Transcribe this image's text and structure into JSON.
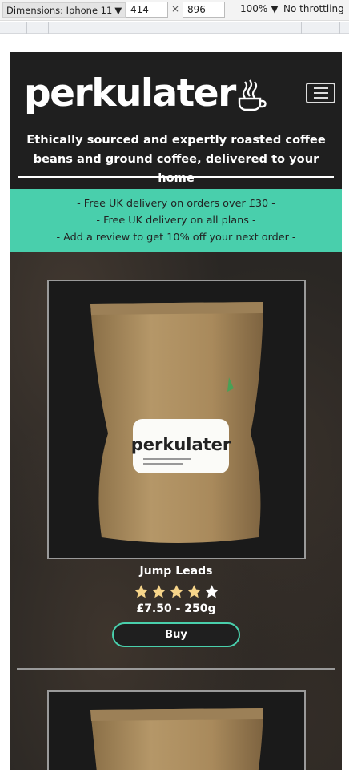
{
  "devtools": {
    "device_label": "Dimensions: Iphone 11",
    "width": "414",
    "height": "896",
    "zoom": "100%",
    "throttling": "No throttling"
  },
  "site": {
    "logo": "perkulater",
    "tagline": "Ethically sourced and expertly roasted coffee beans and ground coffee, delivered to your home",
    "promos": [
      "- Free UK delivery on orders over £30 -",
      "- Free UK delivery on all plans -",
      "- Add a review to get 10% off your next order -"
    ]
  },
  "products": [
    {
      "name": "Jump Leads",
      "rating": 4,
      "rating_max": 5,
      "price": "£7.50 - 250g",
      "buy_label": "Buy",
      "bag_label": "perkulater"
    }
  ],
  "colors": {
    "accent": "#49cfac",
    "background": "#1f1f1f"
  }
}
